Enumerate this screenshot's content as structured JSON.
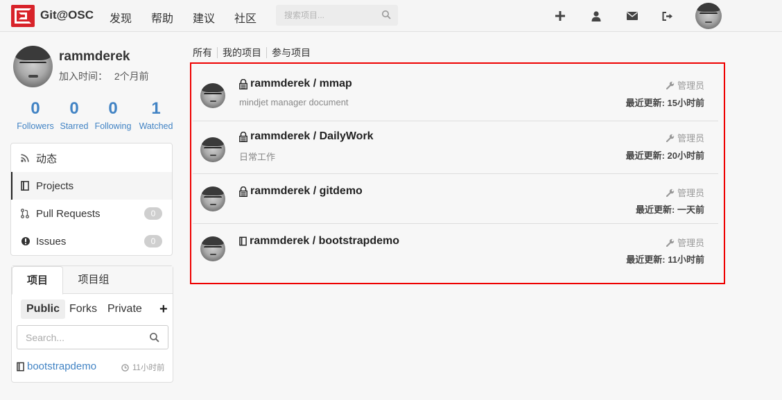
{
  "header": {
    "brand": "Git@OSC",
    "nav": [
      "发现",
      "帮助",
      "建议",
      "社区"
    ],
    "search_placeholder": "搜索项目..."
  },
  "profile": {
    "name": "rammderek",
    "joined_label": "加入时间：",
    "joined_value": "2个月前",
    "stats": [
      {
        "num": "0",
        "label": "Followers"
      },
      {
        "num": "0",
        "label": "Starred"
      },
      {
        "num": "0",
        "label": "Following"
      },
      {
        "num": "1",
        "label": "Watched"
      }
    ]
  },
  "menu": {
    "items": [
      {
        "label": "动态",
        "icon": "rss-icon"
      },
      {
        "label": "Projects",
        "icon": "book-icon"
      },
      {
        "label": "Pull Requests",
        "icon": "pull-request-icon",
        "badge": "0"
      },
      {
        "label": "Issues",
        "icon": "alert-icon",
        "badge": "0"
      }
    ]
  },
  "project_panel": {
    "tabs": [
      "项目",
      "项目组"
    ],
    "filters": [
      "Public",
      "Forks",
      "Private"
    ],
    "add": "+",
    "search_placeholder": "Search...",
    "item": {
      "name": "bootstrapdemo",
      "time": "11小时前"
    }
  },
  "main_tabs": [
    "所有",
    "我的项目",
    "参与项目"
  ],
  "projects": [
    {
      "title": "rammderek / mmap",
      "desc": "mindjet manager document",
      "role": "管理员",
      "updated_label": "最近更新:",
      "updated_value": "15小时前",
      "private": true
    },
    {
      "title": "rammderek / DailyWork",
      "desc": "日常工作",
      "role": "管理员",
      "updated_label": "最近更新:",
      "updated_value": "20小时前",
      "private": true
    },
    {
      "title": "rammderek / gitdemo",
      "desc": "",
      "role": "管理员",
      "updated_label": "最近更新:",
      "updated_value": "一天前",
      "private": true
    },
    {
      "title": "rammderek / bootstrapdemo",
      "desc": "",
      "role": "管理员",
      "updated_label": "最近更新:",
      "updated_value": "11小时前",
      "private": false
    }
  ],
  "colors": {
    "accent": "#4183c4",
    "brand": "#d8232a",
    "highlight_border": "#ee0000"
  }
}
